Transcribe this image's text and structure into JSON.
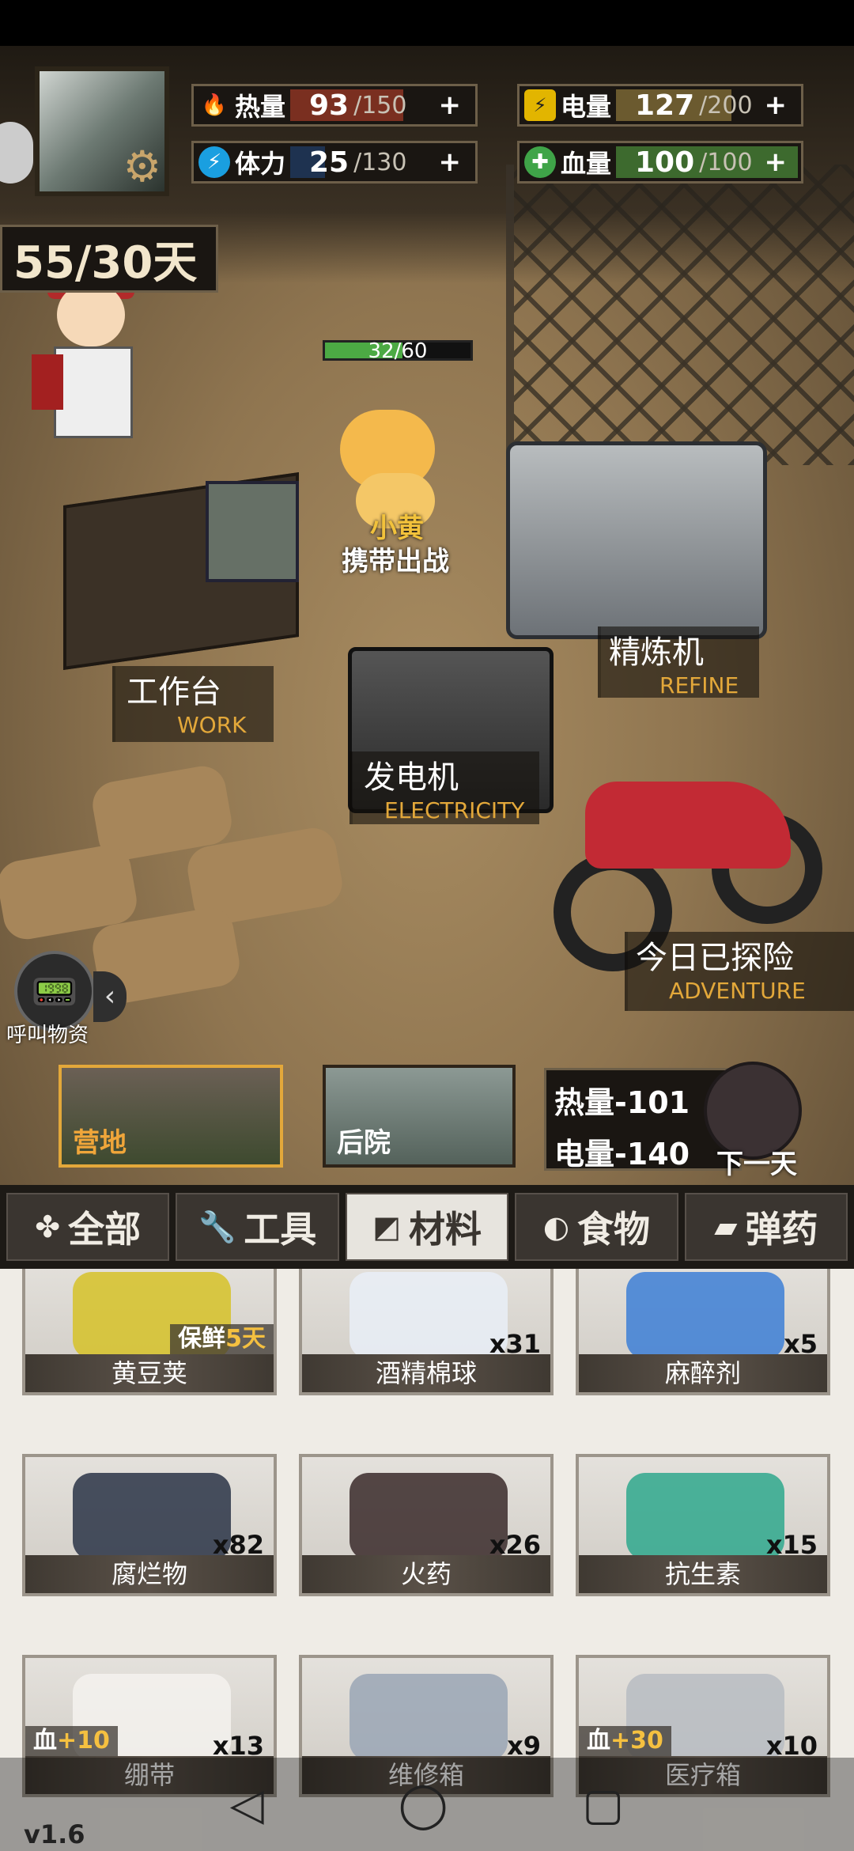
{
  "stats": {
    "heat": {
      "label": "热量",
      "value": "93",
      "max": "/150",
      "plus": "+",
      "color": "#7a2f20",
      "fraction": 0.62
    },
    "power": {
      "label": "电量",
      "value": "127",
      "max": "/200",
      "plus": "+",
      "color": "#6b5a2f",
      "fraction": 0.635
    },
    "stamina": {
      "label": "体力",
      "value": "25",
      "max": "/130",
      "plus": "+",
      "color": "#1e3250",
      "fraction": 0.19
    },
    "blood": {
      "label": "血量",
      "value": "100",
      "max": "/100",
      "plus": "+",
      "color": "#3d6a2e",
      "fraction": 1.0
    }
  },
  "days": "55/30天",
  "pet": {
    "hp": "32/60",
    "hp_fraction": 0.533,
    "name": "小黄",
    "action": "携带出战"
  },
  "stations": {
    "work": {
      "cn": "工作台",
      "en": "WORK"
    },
    "refine": {
      "cn": "精炼机",
      "en": "REFINE"
    },
    "electricity": {
      "cn": "发电机",
      "en": "ELECTRICITY"
    },
    "adventure": {
      "cn": "今日已探险",
      "en": "ADVENTURE"
    }
  },
  "call_supply": "呼叫物资",
  "areas": {
    "camp": "营地",
    "backyard": "后院"
  },
  "next_day": {
    "heat": "热量-101",
    "power": "电量-140",
    "label": "下一天"
  },
  "tabs": [
    {
      "icon": "✤",
      "label": "全部"
    },
    {
      "icon": "🔧",
      "label": "工具"
    },
    {
      "icon": "◩",
      "label": "材料"
    },
    {
      "icon": "◐",
      "label": "食物"
    },
    {
      "icon": "▰",
      "label": "弹药"
    }
  ],
  "active_tab": "材料",
  "items": [
    {
      "name": "黄豆荚",
      "count": "",
      "tag_prefix": "保鲜",
      "tag_value": "5天",
      "icon": "bean-pod-icon"
    },
    {
      "name": "酒精棉球",
      "count": "x31",
      "icon": "alcohol-cotton-icon"
    },
    {
      "name": "麻醉剂",
      "count": "x5",
      "icon": "syringe-icon"
    },
    {
      "name": "腐烂物",
      "count": "x82",
      "icon": "rot-icon"
    },
    {
      "name": "火药",
      "count": "x26",
      "icon": "gunpowder-icon"
    },
    {
      "name": "抗生素",
      "count": "x15",
      "icon": "antibiotic-icon"
    },
    {
      "name": "绷带",
      "count": "x13",
      "tag_prefix": "血",
      "tag_value": "+10",
      "icon": "bandage-icon"
    },
    {
      "name": "维修箱",
      "count": "x9",
      "icon": "repair-box-icon"
    },
    {
      "name": "医疗箱",
      "count": "x10",
      "tag_prefix": "血",
      "tag_value": "+30",
      "icon": "medkit-icon"
    }
  ],
  "version": "v1.6"
}
